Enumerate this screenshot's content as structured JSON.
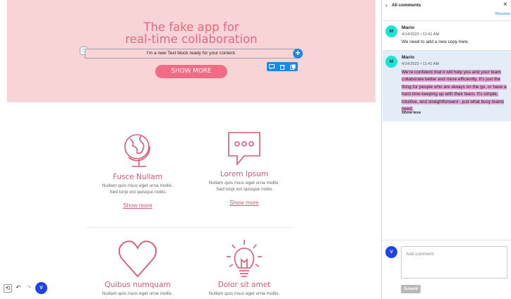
{
  "hero": {
    "title_line1": "The fake app for",
    "title_line2": "real-time collaboration",
    "text_block": "I'm a new Text block ready for your content.",
    "button_label": "SHOW MORE"
  },
  "features": [
    {
      "title": "Fusce Nullam",
      "text_line1": "Nullam quis risus eget urna mollis.",
      "text_line2": "Sed turpi est quisque nobis",
      "link": "Show more",
      "icon": "globe-icon"
    },
    {
      "title": "Lorem Ipsum",
      "text_line1": "Nullam quis risus eget urna mollis.",
      "text_line2": "Sed turpi est quisque nobis",
      "link": "Show more",
      "icon": "chat-bubble-icon"
    },
    {
      "title": "Quibus numquam",
      "text_line1": "Nullam quis risus eget urna mollis.",
      "icon": "heart-icon"
    },
    {
      "title": "Dolor sit amet",
      "text_line1": "Nullam quis risus eget urna mollis.",
      "icon": "lightbulb-icon"
    }
  ],
  "bottombar": {
    "avatar_initial": "V"
  },
  "panel": {
    "title": "All comments",
    "resolve_label": "Resolve",
    "comments": [
      {
        "initial": "M",
        "author": "Mario",
        "date": "4/14/2022 • 11:41 AM",
        "text": "We need to add a new copy here."
      },
      {
        "initial": "M",
        "author": "Mario",
        "date": "4/14/2022 • 11:41 AM",
        "text": "We're confident that it will help you and your team collaborate better and more efficiently. It's just the thing for people who are always on the go, or have a hard time keeping up with their team. It's simple, intuitive, and straightforward - just what busy teams need.",
        "show_less": "Show less"
      }
    ],
    "composer": {
      "avatar_initial": "V",
      "placeholder": "Add comment",
      "submit_label": "Submit"
    }
  },
  "colors": {
    "accent": "#e7687d",
    "hero_bg": "#f8d4d6",
    "blue": "#1e88e5",
    "avatar_v": "#1f45e0",
    "avatar_m": "#19e6d8",
    "highlight": "#e7a3d6"
  }
}
